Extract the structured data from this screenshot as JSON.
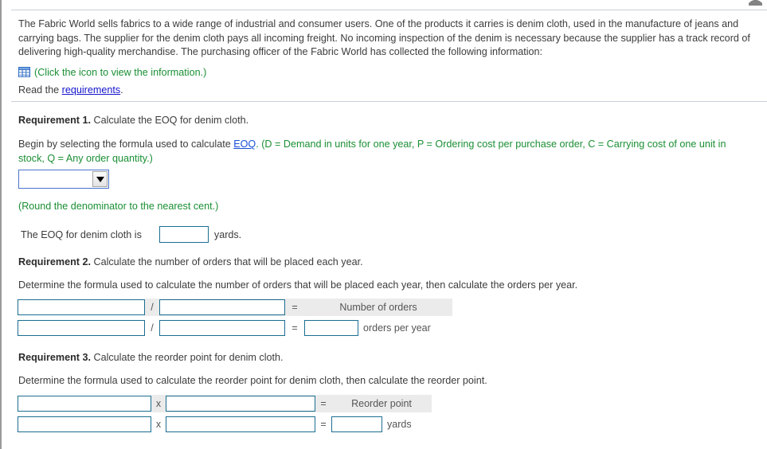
{
  "window": {
    "scroll_artifact_icon": "scroll-up-arrow-icon"
  },
  "intro": {
    "paragraph": "The Fabric World sells fabrics to a wide range of industrial and consumer users. One of the products it carries is denim cloth, used in the manufacture of jeans and carrying bags. The supplier for the denim cloth pays all incoming freight. No incoming inspection of the denim is necessary because the supplier has a track record of delivering high-quality merchandise. The purchasing officer of the Fabric World has collected the following information:",
    "icon_name": "table-grid-icon",
    "icon_caption": "(Click the icon to view the information.)",
    "read_prefix": "Read the ",
    "read_link": "requirements",
    "read_suffix": "."
  },
  "requirement1": {
    "label": "Requirement 1.",
    "title": " Calculate the EOQ for denim cloth.",
    "instruction_prefix": "Begin by selecting the formula used to calculate ",
    "instruction_link": "EOQ",
    "instruction_suffix": ". (D = Demand in units for one year, P = Ordering cost per purchase order, C = Carrying cost of one unit in stock, Q = Any order quantity.)",
    "dropdown_value": "",
    "dropdown_arrow_icon": "chevron-down-icon",
    "round_note": "(Round the denominator to the nearest cent.)",
    "answer_prefix": "The EOQ for denim cloth is",
    "answer_value": "",
    "answer_unit": "yards."
  },
  "requirement2": {
    "label": "Requirement 2.",
    "title": " Calculate the number of orders that will be placed each year.",
    "instruction": "Determine the formula used to calculate the number of orders that will be placed each year, then calculate the orders per year.",
    "operator": "/",
    "equals": "=",
    "result_label": "Number of orders",
    "result_unit": "orders per year",
    "rows": [
      {
        "operand1": "",
        "operand2": "",
        "result": null
      },
      {
        "operand1": "",
        "operand2": "",
        "result": ""
      }
    ]
  },
  "requirement3": {
    "label": "Requirement 3.",
    "title": " Calculate the reorder point for denim cloth.",
    "instruction": "Determine the formula used to calculate the reorder point for denim cloth, then calculate the reorder point.",
    "operator": "x",
    "equals": "=",
    "result_label": "Reorder point",
    "result_unit": "yards",
    "rows": [
      {
        "operand1": "",
        "operand2": "",
        "result": null
      },
      {
        "operand1": "",
        "operand2": "",
        "result": ""
      }
    ]
  },
  "colors": {
    "green_note": "#1a8f34",
    "link_blue": "#1414cc",
    "input_border": "#1b6e91",
    "select_border": "#4a74c9",
    "shaded_cell": "#ebebeb",
    "rule": "#c8d0da"
  }
}
